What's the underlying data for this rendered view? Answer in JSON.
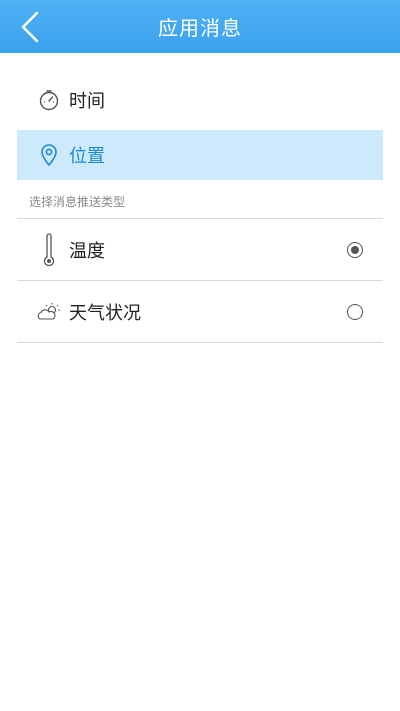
{
  "header": {
    "title": "应用消息"
  },
  "menu": {
    "items": [
      {
        "label": "时间",
        "icon": "stopwatch-icon",
        "selected": false
      },
      {
        "label": "位置",
        "icon": "location-pin-icon",
        "selected": true
      }
    ]
  },
  "section": {
    "caption": "选择消息推送类型"
  },
  "options": [
    {
      "label": "温度",
      "icon": "thermometer-icon",
      "checked": true
    },
    {
      "label": "天气状况",
      "icon": "partly-cloudy-icon",
      "checked": false
    }
  ],
  "colors": {
    "header_bg": "#3aa2ee",
    "selected_bg": "#cdeafc",
    "selected_text": "#1e88d2",
    "divider": "#d9d9d9"
  }
}
